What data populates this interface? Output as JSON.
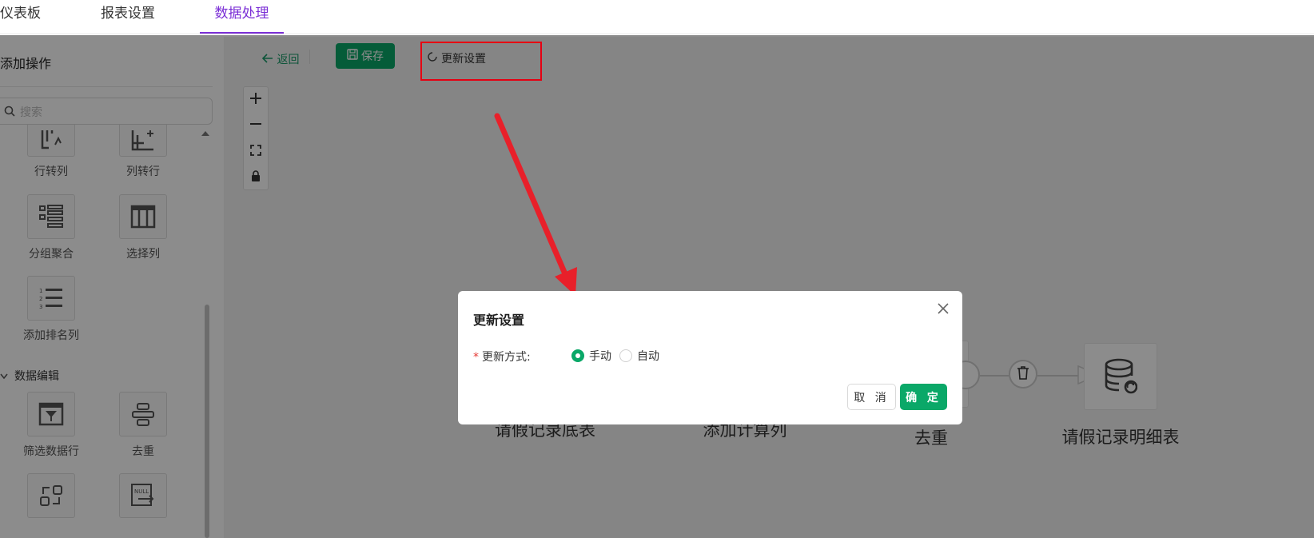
{
  "tabs": [
    {
      "label": "仪表板",
      "active": false
    },
    {
      "label": "报表设置",
      "active": false
    },
    {
      "label": "数据处理",
      "active": true
    }
  ],
  "sidebar": {
    "title": "添加操作",
    "search_placeholder": "搜索",
    "operations": [
      {
        "label": "行转列",
        "icon": "row-to-column-icon"
      },
      {
        "label": "列转行",
        "icon": "column-to-row-icon"
      },
      {
        "label": "分组聚合",
        "icon": "group-aggregate-icon"
      },
      {
        "label": "选择列",
        "icon": "select-columns-icon"
      },
      {
        "label": "添加排名列",
        "icon": "ranked-list-icon"
      }
    ],
    "section_data_edit": "数据编辑",
    "edit_operations": [
      {
        "label": "筛选数据行",
        "icon": "filter-rows-icon"
      },
      {
        "label": "去重",
        "icon": "dedupe-icon"
      },
      {
        "label": "",
        "icon": "replace-icon"
      },
      {
        "label": "",
        "icon": "null-replace-icon"
      }
    ]
  },
  "toolbar": {
    "back_label": "返回",
    "save_label": "保存",
    "update_settings_label": "更新设置"
  },
  "flow_nodes": [
    {
      "label": "请假记录底表"
    },
    {
      "label": "添加计算列"
    },
    {
      "label": "去重"
    },
    {
      "label": "请假记录明细表"
    }
  ],
  "modal": {
    "title": "更新设置",
    "field_label": "更新方式:",
    "options": [
      {
        "label": "手动",
        "selected": true
      },
      {
        "label": "自动",
        "selected": false
      }
    ],
    "cancel_label": "取 消",
    "ok_label": "确 定"
  },
  "colors": {
    "accent_purple": "#7b2fd6",
    "primary_green": "#0aa868",
    "annotation_red": "#e60012"
  }
}
